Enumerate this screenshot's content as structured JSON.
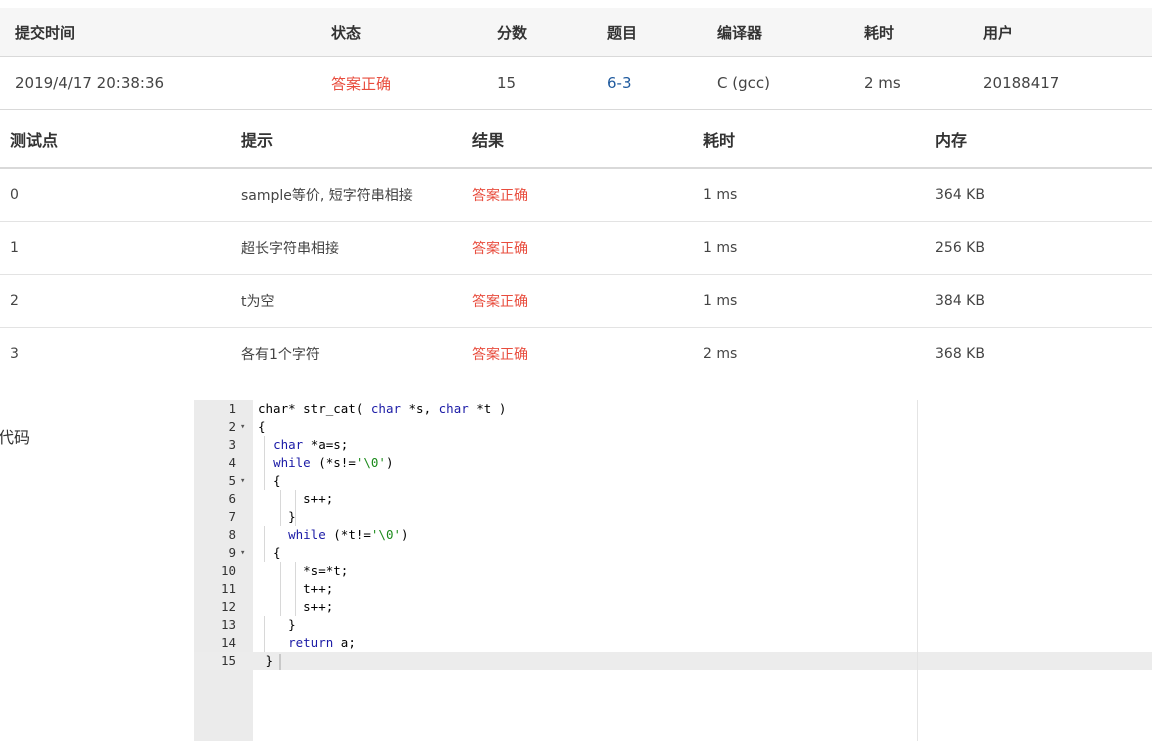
{
  "submission": {
    "headers": [
      "提交时间",
      "状态",
      "分数",
      "题目",
      "编译器",
      "耗时",
      "用户"
    ],
    "row": {
      "time": "2019/4/17 20:38:36",
      "status": "答案正确",
      "score": "15",
      "problem": "6-3",
      "compiler": "C (gcc)",
      "duration": "2 ms",
      "user": "20188417"
    }
  },
  "cases": {
    "headers": [
      "测试点",
      "提示",
      "结果",
      "耗时",
      "内存"
    ],
    "rows": [
      {
        "point": "0",
        "hint": "sample等价, 短字符串相接",
        "result": "答案正确",
        "time": "1 ms",
        "memory": "364 KB"
      },
      {
        "point": "1",
        "hint": "超长字符串相接",
        "result": "答案正确",
        "time": "1 ms",
        "memory": "256 KB"
      },
      {
        "point": "2",
        "hint": "t为空",
        "result": "答案正确",
        "time": "1 ms",
        "memory": "384 KB"
      },
      {
        "point": "3",
        "hint": "各有1个字符",
        "result": "答案正确",
        "time": "2 ms",
        "memory": "368 KB"
      }
    ]
  },
  "code_section": {
    "label": "代码",
    "lines": [
      "char* str_cat( char *s, char *t )",
      "{",
      "  char *a=s;",
      "  while (*s!='\\0')",
      "  {",
      "      s++;",
      "    }",
      "    while (*t!='\\0')",
      "  {",
      "      *s=*t;",
      "      t++;",
      "      s++;",
      "    }",
      "    return a;",
      " }"
    ],
    "line_numbers": [
      "1",
      "2",
      "3",
      "4",
      "5",
      "6",
      "7",
      "8",
      "9",
      "10",
      "11",
      "12",
      "13",
      "14",
      "15"
    ],
    "fold_lines": [
      2,
      5,
      9
    ],
    "active_line": 15
  },
  "colors": {
    "accepted": "#e84c3d",
    "link": "#1f5a9e",
    "keyword": "#1a1aa6",
    "string": "#1a8a1a",
    "gutter": "#ebebeb"
  }
}
